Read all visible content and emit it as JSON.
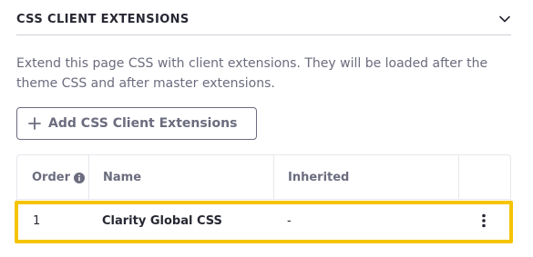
{
  "section": {
    "title": "CSS CLIENT EXTENSIONS"
  },
  "description": "Extend this page CSS with client extensions. They will be loaded after the theme CSS and after master extensions.",
  "add_button": {
    "label": "Add CSS Client Extensions",
    "icon": "plus-icon"
  },
  "table": {
    "headers": [
      "Order",
      "Name",
      "Inherited",
      ""
    ],
    "rows": [
      {
        "order": "1",
        "name": "Clarity Global CSS",
        "inherited": "-"
      }
    ]
  },
  "colors": {
    "highlight": "#f5c400",
    "text": "#272833",
    "muted": "#6b6c7e",
    "border": "#e7e7ed"
  }
}
